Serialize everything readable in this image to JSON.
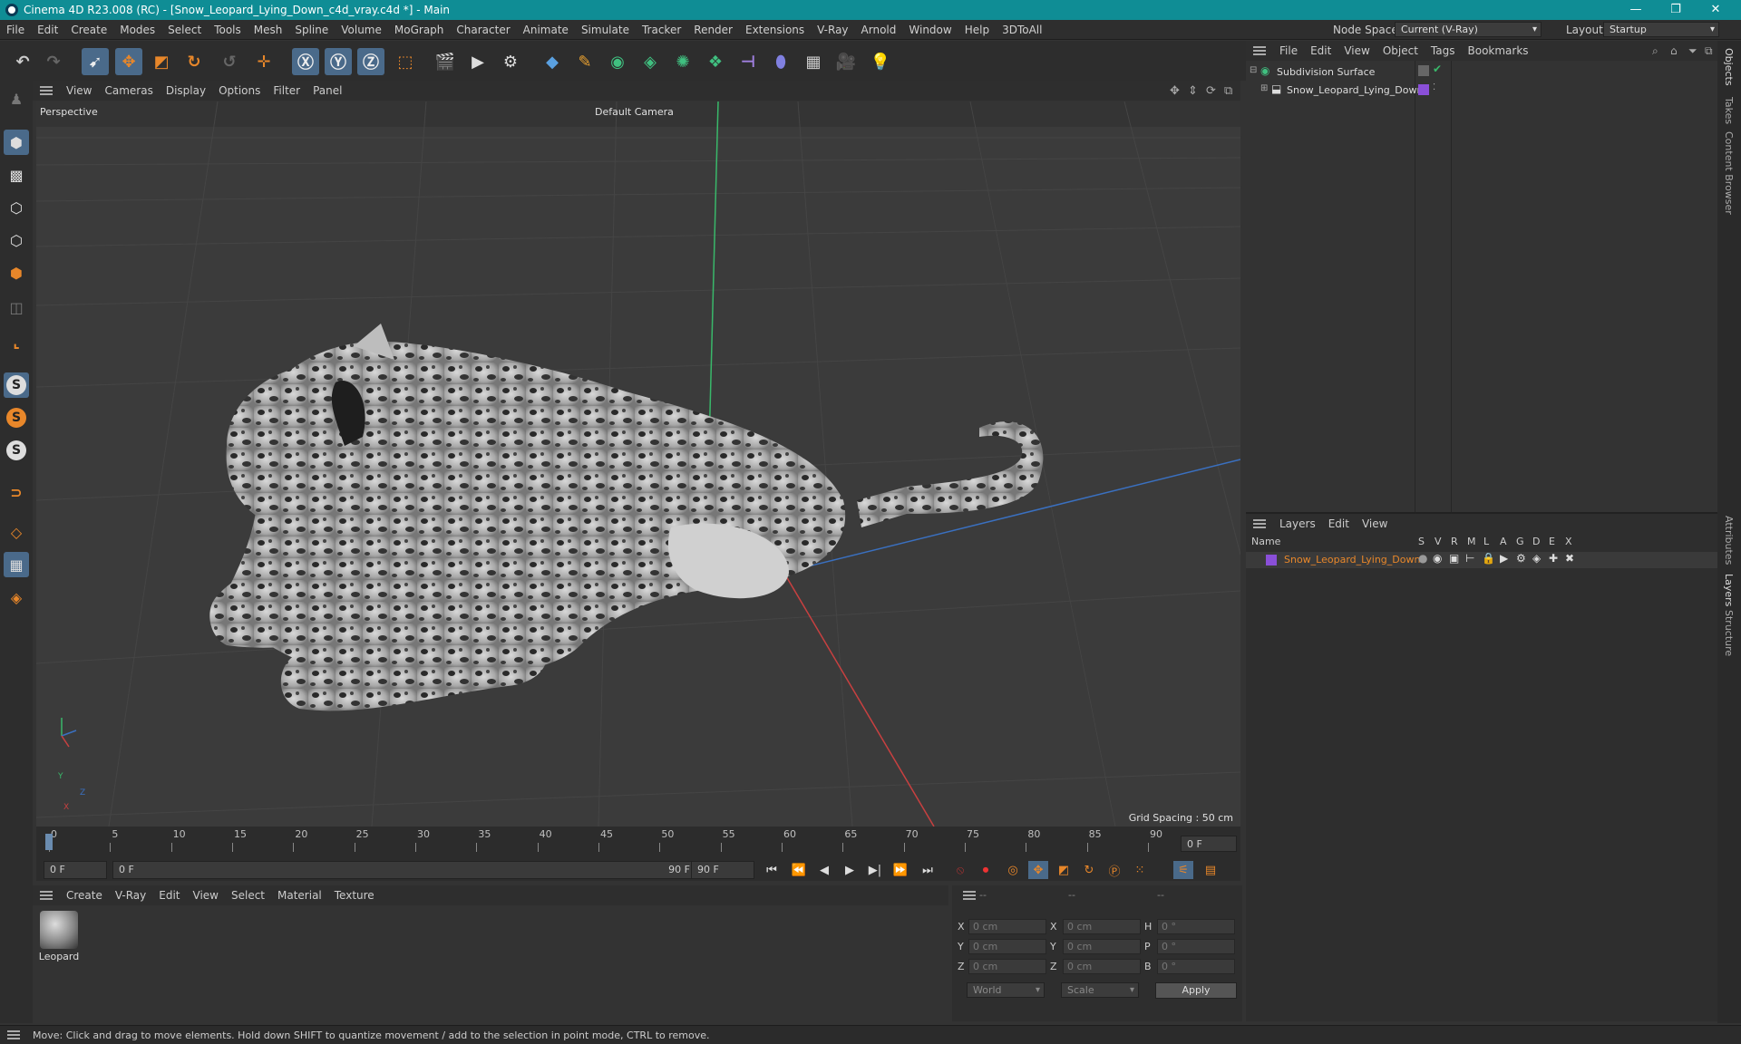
{
  "window": {
    "title": "Cinema 4D R23.008 (RC) - [Snow_Leopard_Lying_Down_c4d_vray.c4d *] - Main",
    "minimize": "—",
    "restore": "❐",
    "close": "✕"
  },
  "menubar": {
    "items": [
      "File",
      "Edit",
      "Create",
      "Modes",
      "Select",
      "Tools",
      "Mesh",
      "Spline",
      "Volume",
      "MoGraph",
      "Character",
      "Animate",
      "Simulate",
      "Tracker",
      "Render",
      "Extensions",
      "V-Ray",
      "Arnold",
      "Window",
      "Help",
      "3DToAll"
    ],
    "node_space_label": "Node Space:",
    "node_space_value": "Current (V-Ray)",
    "layout_label": "Layout:",
    "layout_value": "Startup"
  },
  "viewport": {
    "menu": [
      "View",
      "Cameras",
      "Display",
      "Options",
      "Filter",
      "Panel"
    ],
    "projection": "Perspective",
    "camera": "Default Camera",
    "grid_spacing": "Grid Spacing : 50 cm",
    "axis_y": "Y",
    "axis_z": "Z",
    "axis_x": "X"
  },
  "timeline": {
    "ticks": [
      "0",
      "5",
      "10",
      "15",
      "20",
      "25",
      "30",
      "35",
      "40",
      "45",
      "50",
      "55",
      "60",
      "65",
      "70",
      "75",
      "80",
      "85",
      "90"
    ],
    "current_frame": "0 F"
  },
  "playback": {
    "start_frame": "0 F",
    "range_start": "0 F",
    "range_end": "90 F",
    "end_frame": "90 F"
  },
  "materials": {
    "menu": [
      "Create",
      "V-Ray",
      "Edit",
      "View",
      "Select",
      "Material",
      "Texture"
    ],
    "items": [
      {
        "name": "Leopard"
      }
    ]
  },
  "coordinates": {
    "header": [
      "--",
      "--",
      "--"
    ],
    "rows": [
      {
        "a_label": "X",
        "a_val": "0 cm",
        "b_label": "X",
        "b_val": "0 cm",
        "c_label": "H",
        "c_val": "0 °"
      },
      {
        "a_label": "Y",
        "a_val": "0 cm",
        "b_label": "Y",
        "b_val": "0 cm",
        "c_label": "P",
        "c_val": "0 °"
      },
      {
        "a_label": "Z",
        "a_val": "0 cm",
        "b_label": "Z",
        "b_val": "0 cm",
        "c_label": "B",
        "c_val": "0 °"
      }
    ],
    "space": "World",
    "mode": "Scale",
    "apply": "Apply"
  },
  "objects": {
    "menu": [
      "File",
      "Edit",
      "View",
      "Object",
      "Tags",
      "Bookmarks"
    ],
    "items": [
      {
        "name": "Subdivision Surface"
      },
      {
        "name": "Snow_Leopard_Lying_Down"
      }
    ]
  },
  "layers": {
    "menu": [
      "Layers",
      "Edit",
      "View"
    ],
    "columns": [
      "Name",
      "S",
      "V",
      "R",
      "M",
      "L",
      "A",
      "G",
      "D",
      "E",
      "X"
    ],
    "items": [
      {
        "name": "Snow_Leopard_Lying_Down",
        "color": "#8a4fd8"
      }
    ]
  },
  "right_tabs": [
    "Objects",
    "Takes",
    "Content Browser",
    "Attributes",
    "Layers",
    "Structure"
  ],
  "status": "Move: Click and drag to move elements. Hold down SHIFT to quantize movement / add to the selection in point mode, CTRL to remove.",
  "colors": {
    "titlebar": "#0f8d95",
    "accent_orange": "#e8872a",
    "layer_name": "#e8872a",
    "selected_tool": "#4a6a8a"
  }
}
